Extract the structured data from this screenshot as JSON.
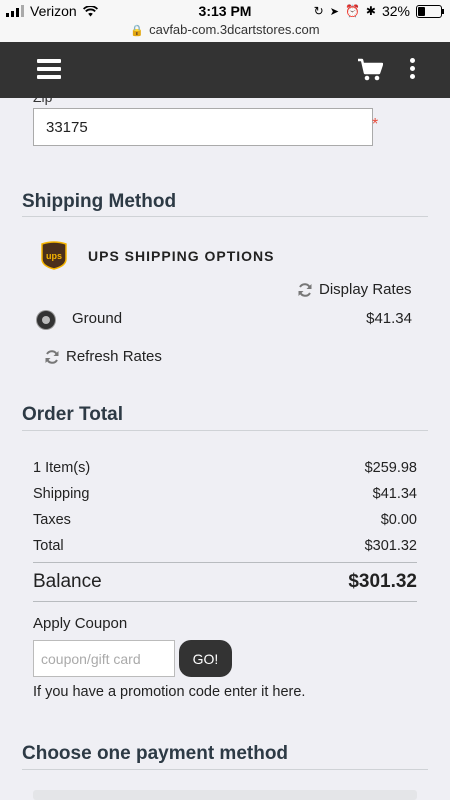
{
  "status_bar": {
    "carrier": "Verizon",
    "time": "3:13 PM",
    "battery": "32%",
    "battery_level": 0.32
  },
  "browser": {
    "url": "cavfab-com.3dcartstores.com"
  },
  "header": {
    "menu_icon": "hamburger-menu-icon",
    "cart_icon": "cart-icon",
    "more_icon": "more-vertical-icon"
  },
  "zip": {
    "label": "Zip",
    "value": "33175",
    "required_mark": "*"
  },
  "shipping": {
    "title": "Shipping Method",
    "carrier_title": "UPS SHIPPING OPTIONS",
    "carrier_logo_text": "ups",
    "display_rates": "Display Rates",
    "option_label": "Ground",
    "option_price": "$41.34",
    "refresh_rates": "Refresh Rates"
  },
  "order_total": {
    "title": "Order Total",
    "rows": [
      {
        "label": "1 Item(s)",
        "value": "$259.98"
      },
      {
        "label": "Shipping",
        "value": "$41.34"
      },
      {
        "label": "Taxes",
        "value": "$0.00"
      },
      {
        "label": "Total",
        "value": "$301.32"
      }
    ],
    "balance_label": "Balance",
    "balance_value": "$301.32"
  },
  "coupon": {
    "label": "Apply Coupon",
    "placeholder": "coupon/gift card",
    "button": "GO!",
    "note": "If you have a promotion code enter it here."
  },
  "payment": {
    "title": "Choose one payment method"
  }
}
